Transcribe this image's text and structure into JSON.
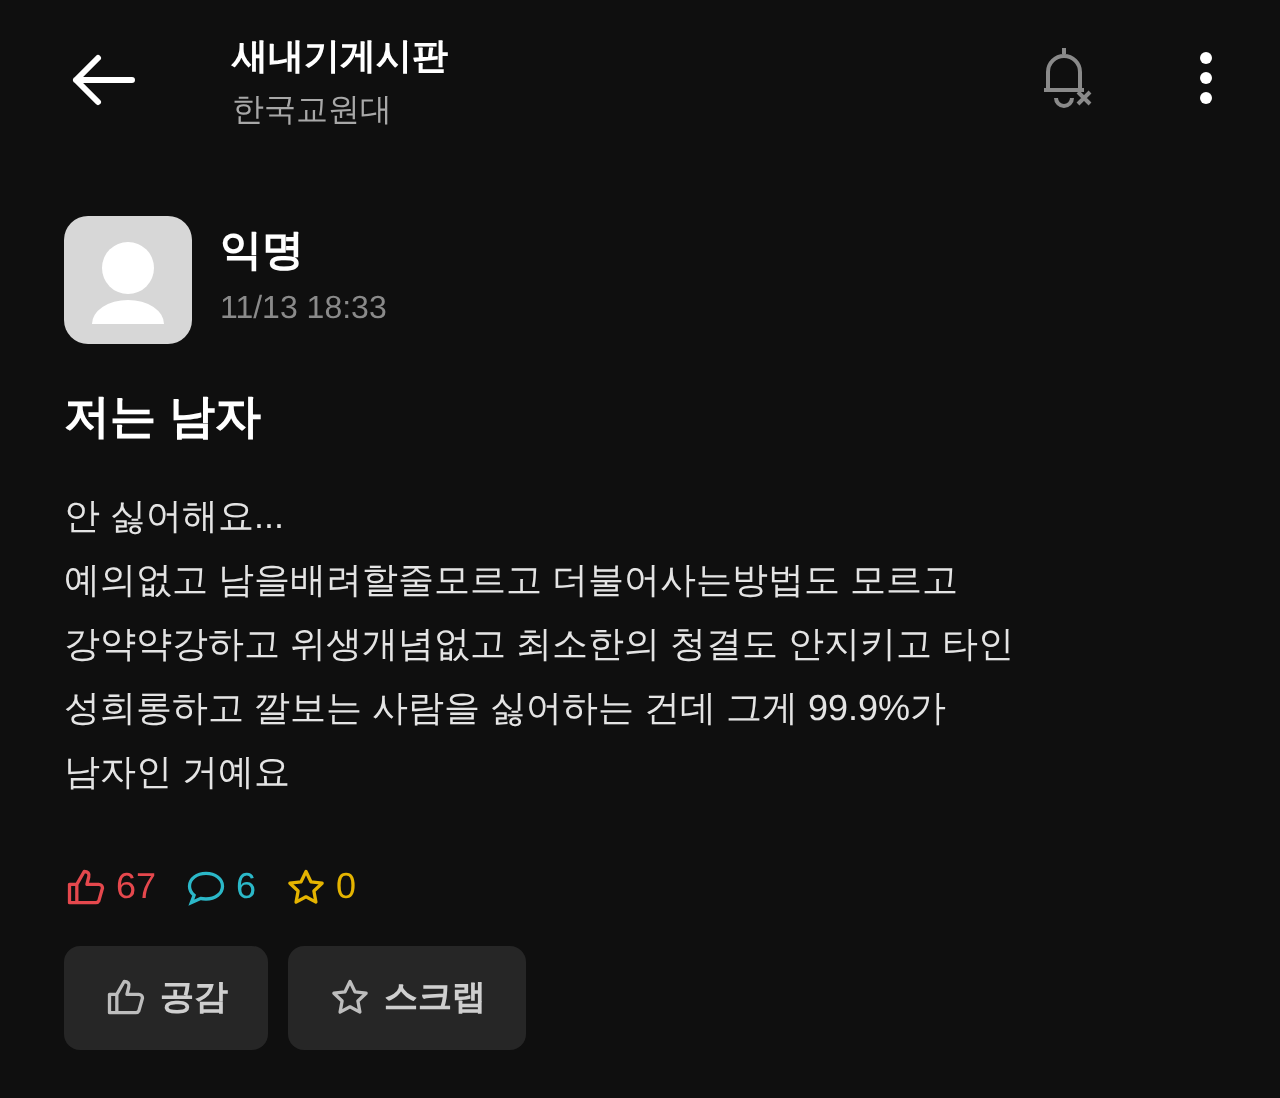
{
  "header": {
    "title": "새내기게시판",
    "subtitle": "한국교원대"
  },
  "post": {
    "author": "익명",
    "time": "11/13 18:33",
    "title": "저는 남자",
    "body": "안 싫어해요...\n예의없고 남을배려할줄모르고 더불어사는방법도 모르고\n강약약강하고 위생개념없고 최소한의 청결도 안지키고 타인\n성희롱하고 깔보는 사람을 싫어하는 건데 그게 99.9%가\n남자인 거예요"
  },
  "stats": [
    {
      "kind": "like",
      "count": "67"
    },
    {
      "kind": "comment",
      "count": "6"
    },
    {
      "kind": "scrap",
      "count": "0"
    }
  ],
  "buttons": [
    {
      "kind": "like",
      "label": "공감"
    },
    {
      "kind": "scrap",
      "label": "스크랩"
    }
  ]
}
